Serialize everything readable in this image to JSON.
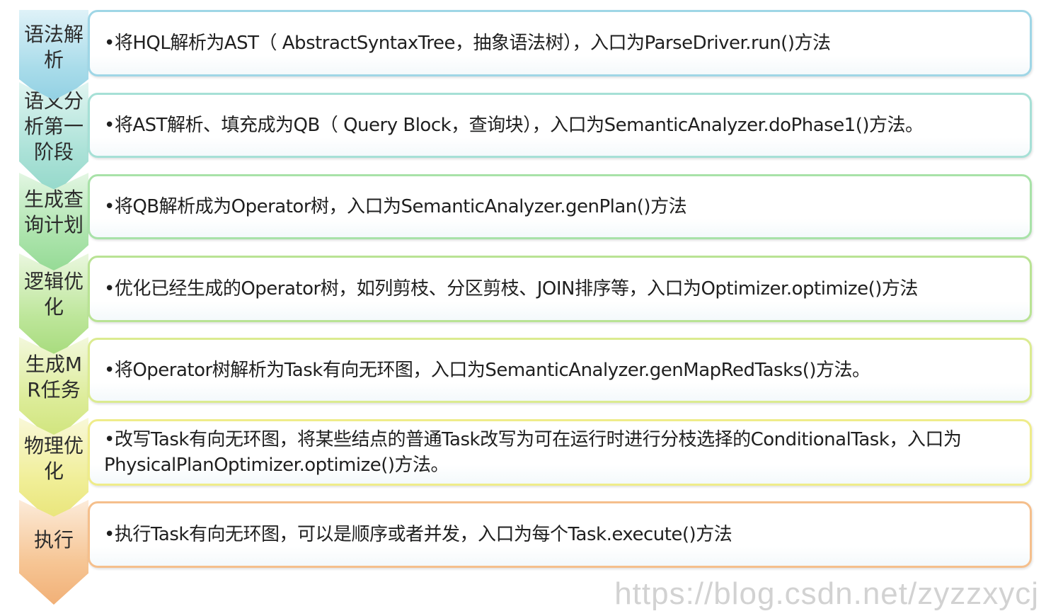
{
  "steps": [
    {
      "label": "语法解析",
      "text": "•将HQL解析为AST（ AbstractSyntaxTree，抽象语法树），入口为ParseDriver.run()方法",
      "color": "#9fd6e6"
    },
    {
      "label": "语义分析第一阶段",
      "text": "•将AST解析、填充成为QB（ Query Block，查询块），入口为SemanticAnalyzer.doPhase1()方法。",
      "color": "#a6e0d6"
    },
    {
      "label": "生成查询计划",
      "text": "•将QB解析成为Operator树，入口为SemanticAnalyzer.genPlan()方法",
      "color": "#a8e2a8"
    },
    {
      "label": "逻辑优化",
      "text": "•优化已经生成的Operator树，如列剪枝、分区剪枝、JOIN排序等，入口为Optimizer.optimize()方法",
      "color": "#b9e394"
    },
    {
      "label": "生成MR任务",
      "text": "•将Operator树解析为Task有向无环图，入口为SemanticAnalyzer.genMapRedTasks()方法。",
      "color": "#dbeb90"
    },
    {
      "label": "物理优化",
      "text": "•改写Task有向无环图，将某些结点的普通Task改写为可在运行时进行分枝选择的ConditionalTask，入口为PhysicalPlanOptimizer.optimize()方法。",
      "color": "#efec8a"
    },
    {
      "label": "执行",
      "text": "•执行Task有向无环图，可以是顺序或者并发，入口为每个Task.execute()方法",
      "color": "#f5bf8c"
    }
  ],
  "watermark": "https://blog.csdn.net/zyzzxycj"
}
